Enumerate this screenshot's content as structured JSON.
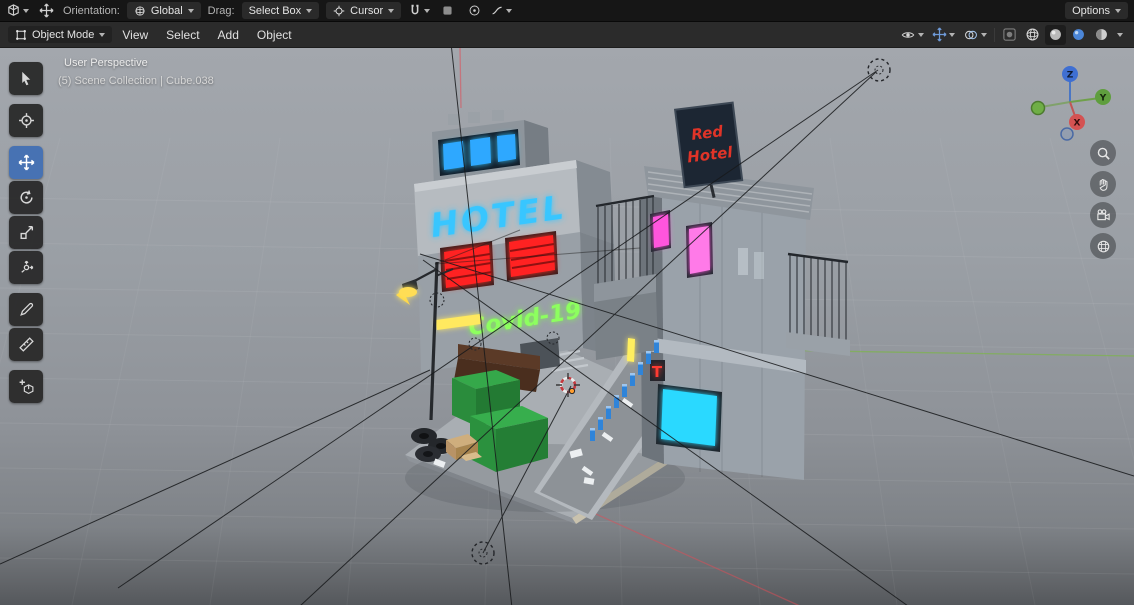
{
  "topbar": {
    "orientation_label": "Orientation:",
    "orientation_value": "Global",
    "drag_label": "Drag:",
    "drag_value": "Select Box",
    "cursor_label": "Cursor",
    "options_label": "Options"
  },
  "header": {
    "mode": "Object Mode",
    "menu_view": "View",
    "menu_select": "Select",
    "menu_add": "Add",
    "menu_object": "Object"
  },
  "viewport": {
    "perspective": "User Perspective",
    "breadcrumb": "(5) Scene Collection | Cube.038"
  },
  "scene": {
    "hotel_sign": "HOTEL",
    "covid_sign": "Covid-19",
    "roof_sign_line1": "Red",
    "roof_sign_line2": "Hotel",
    "shop_sign": "T"
  },
  "gizmo": {
    "x": "X",
    "y": "Y",
    "z": "Z"
  },
  "colors": {
    "accent": "#4772b3",
    "neon_blue": "#38c6ff",
    "neon_red": "#ff2222",
    "neon_green": "#8dff5e",
    "neon_pink": "#ff55dd",
    "neon_cyan": "#29d9ff",
    "neon_yellow": "#ffe95e"
  },
  "icons": {
    "editor_type": "3d-viewport-cube",
    "active_tool": "move-cross-arrows",
    "orientation": "globe",
    "cursor": "crosshair",
    "snap": "magnet",
    "proportional": "circle-dot",
    "falloff": "curve",
    "visibility": "eye",
    "gizmos": "blue-arrows",
    "overlays": "two-circles",
    "render_pass": "sphere-in-square",
    "shading": [
      "wireframe-sphere",
      "solid-sphere",
      "material-sphere",
      "rendered-sphere"
    ],
    "tools": [
      "select-box",
      "cursor",
      "move",
      "rotate",
      "scale",
      "transform",
      "annotate",
      "measure",
      "add-cube"
    ],
    "nav": [
      "zoom",
      "pan",
      "camera",
      "ortho-grid"
    ]
  }
}
